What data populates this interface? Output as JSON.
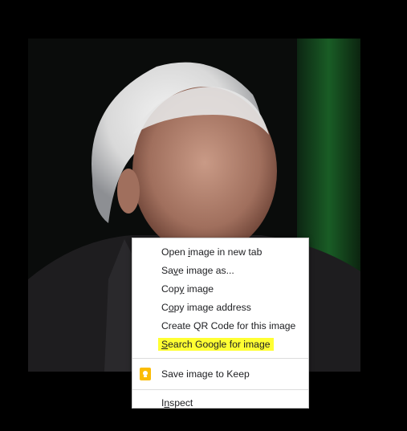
{
  "image": {
    "description_icon": "photo-of-man-in-dark-suit"
  },
  "context_menu": {
    "items": [
      {
        "before": "Open ",
        "key": "i",
        "after": "mage in new tab"
      },
      {
        "before": "Sa",
        "key": "v",
        "after": "e image as..."
      },
      {
        "before": "Cop",
        "key": "y",
        "after": " image"
      },
      {
        "before": "C",
        "key": "o",
        "after": "py image address"
      },
      {
        "before": "Create QR Code for this image",
        "key": "",
        "after": ""
      },
      {
        "before": "",
        "key": "S",
        "after": "earch Google for image"
      },
      {
        "before": "Save image to Keep",
        "key": "",
        "after": ""
      },
      {
        "before": "I",
        "key": "n",
        "after": "spect"
      }
    ],
    "highlight_color": "#ffff33",
    "keep_icon": "google-keep-icon",
    "keep_color": "#fbbc04"
  }
}
